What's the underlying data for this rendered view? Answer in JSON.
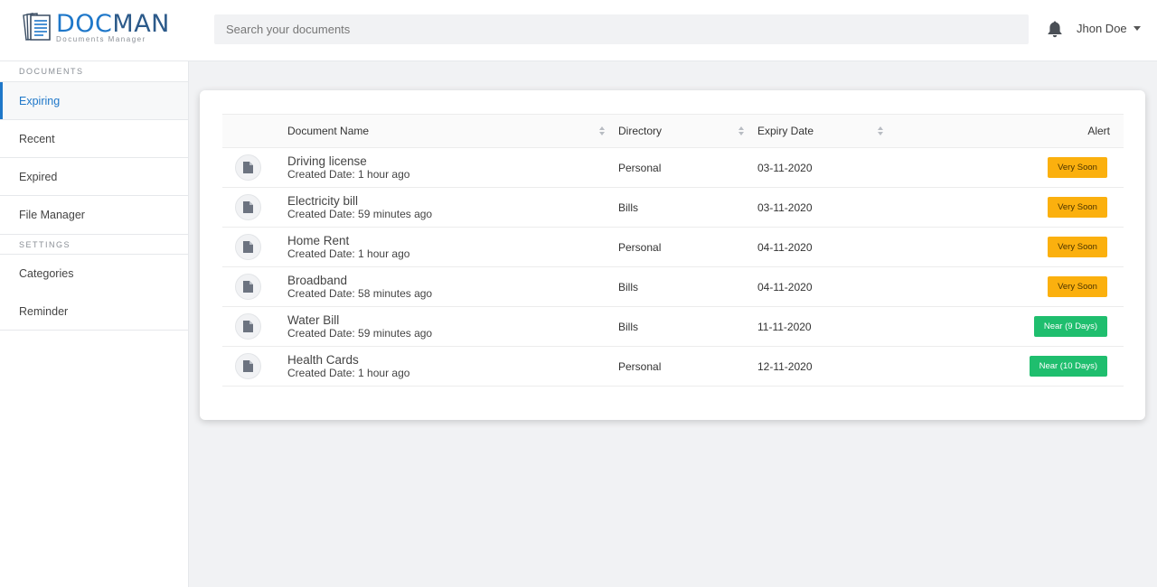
{
  "app": {
    "logo_title": "DOCMAN",
    "logo_title_a": "DOC",
    "logo_title_b": "MAN",
    "logo_subtitle": "Documents Manager",
    "brand_color": "#1e77c9"
  },
  "header": {
    "search_placeholder": "Search your documents",
    "user_name": "Jhon Doe",
    "bell_icon": "bell-icon"
  },
  "sidebar": {
    "documents_label": "DOCUMENTS",
    "settings_label": "SETTINGS",
    "items": [
      {
        "label": "Expiring",
        "active": true
      },
      {
        "label": "Recent"
      },
      {
        "label": "Expired"
      },
      {
        "label": "File Manager"
      }
    ],
    "settings_items": [
      {
        "label": "Categories"
      },
      {
        "label": "Reminder"
      }
    ]
  },
  "table": {
    "columns": [
      "Document Name",
      "Directory",
      "Expiry Date",
      "Alert"
    ],
    "rows": [
      {
        "name": "Driving license",
        "created": "Created Date: 1 hour ago",
        "directory": "Personal",
        "expiry": "03-11-2020",
        "alert": "Very Soon",
        "alert_type": "soon"
      },
      {
        "name": "Electricity bill",
        "created": "Created Date: 59 minutes ago",
        "directory": "Bills",
        "expiry": "03-11-2020",
        "alert": "Very Soon",
        "alert_type": "soon"
      },
      {
        "name": "Home Rent",
        "created": "Created Date: 1 hour ago",
        "directory": "Personal",
        "expiry": "04-11-2020",
        "alert": "Very Soon",
        "alert_type": "soon"
      },
      {
        "name": "Broadband",
        "created": "Created Date: 58 minutes ago",
        "directory": "Bills",
        "expiry": "04-11-2020",
        "alert": "Very Soon",
        "alert_type": "soon"
      },
      {
        "name": "Water Bill",
        "created": "Created Date: 59 minutes ago",
        "directory": "Bills",
        "expiry": "11-11-2020",
        "alert": "Near (9 Days)",
        "alert_type": "near"
      },
      {
        "name": "Health Cards",
        "created": "Created Date: 1 hour ago",
        "directory": "Personal",
        "expiry": "12-11-2020",
        "alert": "Near (10 Days)",
        "alert_type": "near"
      }
    ]
  },
  "colors": {
    "soon": "#fbb00e",
    "near": "#1fbe6e"
  }
}
